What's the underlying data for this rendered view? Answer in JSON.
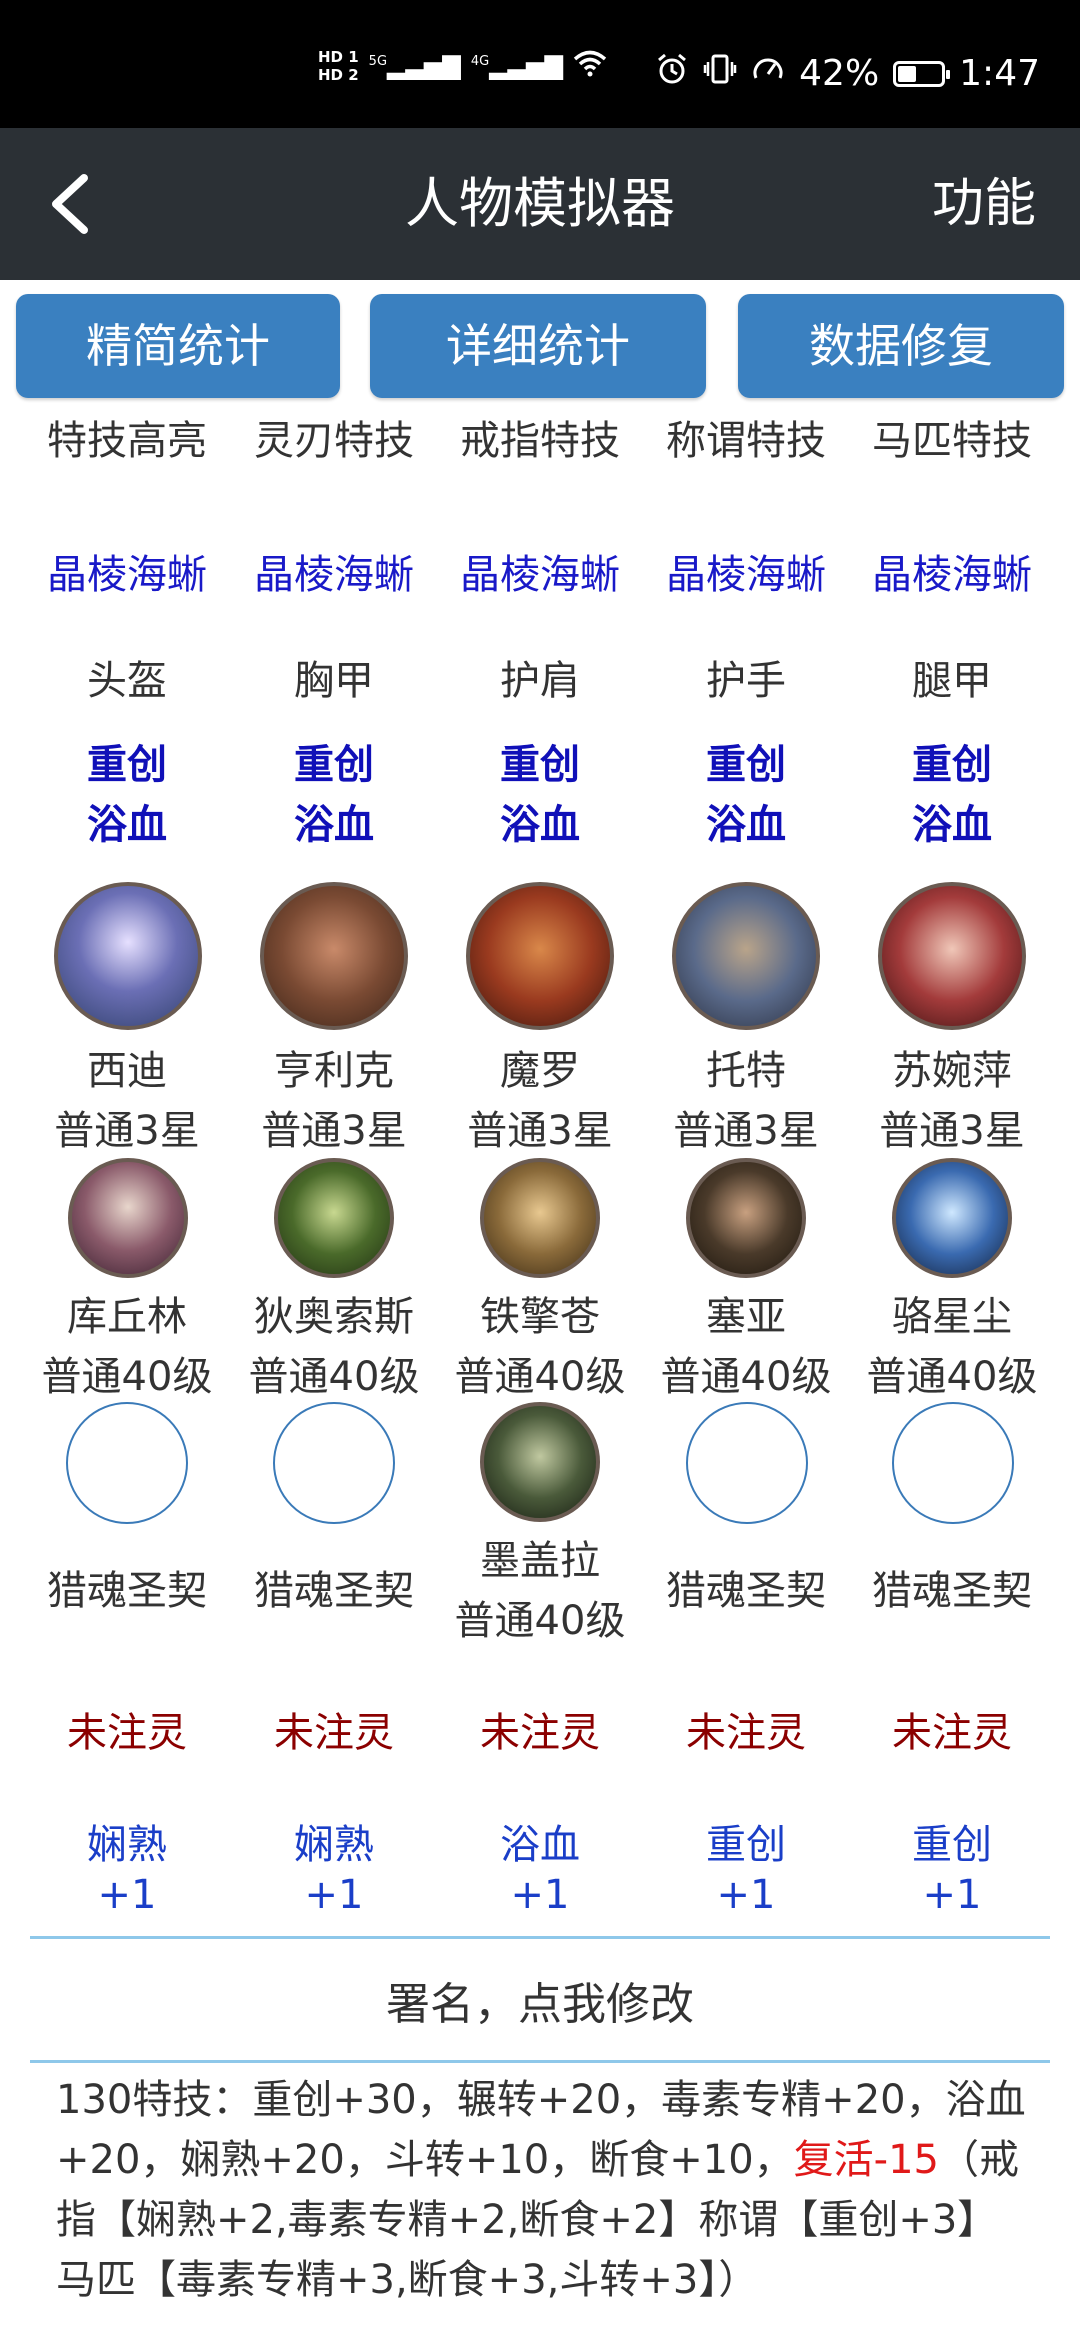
{
  "status_bar": {
    "hd1": "HD 1",
    "hd2": "HD 2",
    "signal1": "5G",
    "signal2": "4G",
    "battery": "42%",
    "battery_level": 0.42,
    "time": "1:47",
    "icons": [
      "alarm-icon",
      "vibrate-icon",
      "speedometer-icon",
      "wifi-icon"
    ]
  },
  "appbar": {
    "title": "人物模拟器",
    "function_label": "功能"
  },
  "buttons": [
    "精简统计",
    "详细统计",
    "数据修复"
  ],
  "skills_header": [
    "特技高亮",
    "灵刃特技",
    "戒指特技",
    "称谓特技",
    "马匹特技"
  ],
  "skills_values": [
    "晶棱海蜥",
    "晶棱海蜥",
    "晶棱海蜥",
    "晶棱海蜥",
    "晶棱海蜥"
  ],
  "armor_header": [
    "头盔",
    "胸甲",
    "护肩",
    "护手",
    "腿甲"
  ],
  "armor_line1": [
    "重创",
    "重创",
    "重创",
    "重创",
    "重创"
  ],
  "armor_line2": [
    "浴血",
    "浴血",
    "浴血",
    "浴血",
    "浴血"
  ],
  "heroes_row1": [
    {
      "name": "西迪",
      "level": "普通3星"
    },
    {
      "name": "亨利克",
      "level": "普通3星"
    },
    {
      "name": "魔罗",
      "level": "普通3星"
    },
    {
      "name": "托特",
      "level": "普通3星"
    },
    {
      "name": "苏婉萍",
      "level": "普通3星"
    }
  ],
  "heroes_row2": [
    {
      "name": "库丘林",
      "level": "普通40级"
    },
    {
      "name": "狄奥索斯",
      "level": "普通40级"
    },
    {
      "name": "铁擎苍",
      "level": "普通40级"
    },
    {
      "name": "塞亚",
      "level": "普通40级"
    },
    {
      "name": "骆星尘",
      "level": "普通40级"
    }
  ],
  "heroes_row3": [
    {
      "label": "猎魂圣契"
    },
    {
      "label": "猎魂圣契"
    },
    {
      "name": "墨盖拉",
      "level": "普通40级"
    },
    {
      "label": "猎魂圣契"
    },
    {
      "label": "猎魂圣契"
    }
  ],
  "spirit_status": [
    "未注灵",
    "未注灵",
    "未注灵",
    "未注灵",
    "未注灵"
  ],
  "bonus_name": [
    "娴熟",
    "娴熟",
    "浴血",
    "重创",
    "重创"
  ],
  "bonus_value": [
    "+1",
    "+1",
    "+1",
    "+1",
    "+1"
  ],
  "signature": "署名，点我修改",
  "summary": {
    "part1": "130特技：重创+30，辗转+20，毒素专精+20，浴血+20，娴熟+20，斗转+10，断食+10，",
    "highlight": "复活-15",
    "part2": "（戒指【娴熟+2,毒素专精+2,断食+2】称谓【重创+3】马匹【毒素专精+3,断食+3,斗转+3】）"
  }
}
